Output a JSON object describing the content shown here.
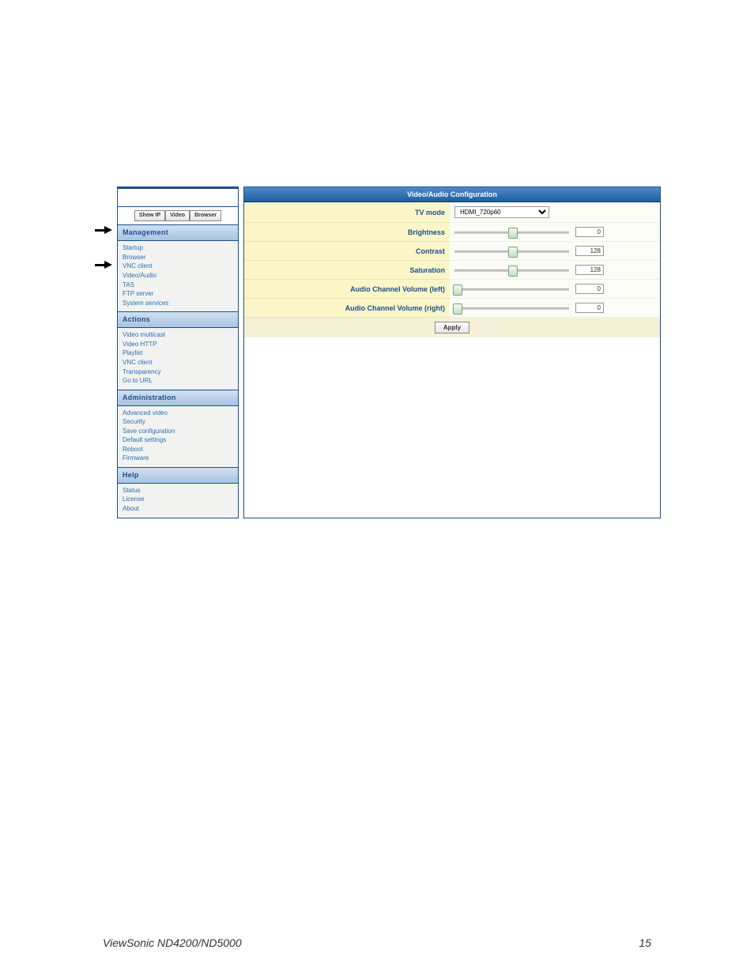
{
  "footer": {
    "product": "ViewSonic ND4200/ND5000",
    "page_number": "15"
  },
  "sidebar": {
    "tabs": [
      "Show IP",
      "Video",
      "Browser"
    ],
    "sections": [
      {
        "header": "Management",
        "items": [
          "Startup",
          "Browser",
          "VNC client",
          "Video/Audio",
          "TAS",
          "FTP server",
          "System services"
        ]
      },
      {
        "header": "Actions",
        "items": [
          "Video multicast",
          "Video HTTP",
          "Playlist",
          "VNC client",
          "Transparency",
          "Go to URL"
        ]
      },
      {
        "header": "Administration",
        "items": [
          "Advanced video",
          "Security",
          "Save configuration",
          "Default settings",
          "Reboot",
          "Firmware"
        ]
      },
      {
        "header": "Help",
        "items": [
          "Status",
          "License",
          "About"
        ]
      }
    ]
  },
  "panel": {
    "title": "Video/Audio Configuration",
    "rows": [
      {
        "label": "TV mode",
        "type": "select",
        "value": "HDMI_720p60"
      },
      {
        "label": "Brightness",
        "type": "slider",
        "value": "0",
        "pos": 50
      },
      {
        "label": "Contrast",
        "type": "slider",
        "value": "128",
        "pos": 50
      },
      {
        "label": "Saturation",
        "type": "slider",
        "value": "128",
        "pos": 50
      },
      {
        "label": "Audio Channel Volume (left)",
        "type": "slider",
        "value": "0",
        "pos": 0
      },
      {
        "label": "Audio Channel Volume (right)",
        "type": "slider",
        "value": "0",
        "pos": 0
      }
    ],
    "apply_label": "Apply"
  }
}
